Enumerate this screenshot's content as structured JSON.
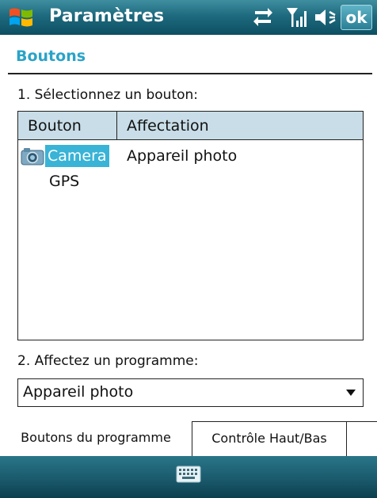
{
  "titlebar": {
    "title": "Paramètres",
    "ok_label": "ok",
    "icons": [
      "windows-start-icon",
      "connectivity-icon",
      "signal-icon",
      "volume-icon"
    ]
  },
  "section": {
    "title": "Boutons"
  },
  "step1": {
    "label": "1. Sélectionnez un bouton:"
  },
  "listview": {
    "columns": [
      "Bouton",
      "Affectation"
    ],
    "rows": [
      {
        "name": "Camera",
        "value": "Appareil photo",
        "selected": true,
        "icon": "camera-icon"
      },
      {
        "name": "GPS",
        "value": "",
        "selected": false
      }
    ]
  },
  "step2": {
    "label": "2. Affectez un programme:"
  },
  "dropdown": {
    "selected": "Appareil photo"
  },
  "tabs": [
    "Boutons du programme",
    "Contrôle Haut/Bas"
  ],
  "colors": {
    "titlebar": "#1e6a7e",
    "accent": "#2aa3c8",
    "selection": "#39b3d6",
    "header_bg": "#c8dde7"
  }
}
